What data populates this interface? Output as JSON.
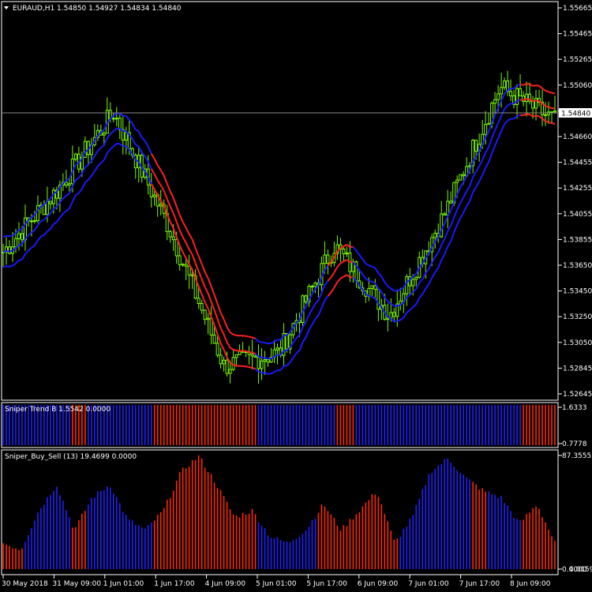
{
  "main_pane": {
    "title": "EURAUD,H1 1.54850 1.54927 1.54834 1.54840",
    "current_price_label": "1.54840",
    "price_ticks": [
      "1.55665",
      "1.55465",
      "1.55265",
      "1.55060",
      "1.54860",
      "1.54660",
      "1.54455",
      "1.54255",
      "1.54055",
      "1.53855",
      "1.53650",
      "1.53450",
      "1.53250",
      "1.53050",
      "1.52845",
      "1.52645"
    ]
  },
  "indicator1": {
    "title": "Sniper Trend B 1.5542 0.0000",
    "ticks": [
      "1.6333",
      "0.7778"
    ]
  },
  "indicator2": {
    "title": "Sniper_Buy_Sell (13) 19.4699 0.0000",
    "ticks": [
      "87.3555",
      "0.0000",
      "4.01598"
    ]
  },
  "time_axis": {
    "labels": [
      "30 May 2018",
      "31 May 09:00",
      "1 Jun 01:00",
      "1 Jun 17:00",
      "4 Jun 09:00",
      "5 Jun 01:00",
      "5 Jun 17:00",
      "6 Jun 09:00",
      "7 Jun 01:00",
      "7 Jun 17:00",
      "8 Jun 09:00"
    ]
  },
  "colors": {
    "background": "#000000",
    "frame": "#ffffff",
    "candles": "#7cfc00",
    "band_up": "#1a1aff",
    "band_down": "#ff2020",
    "hist_red": "#ff2a00",
    "hist_blue": "#2020ff",
    "price_line": "#8c8c8c"
  },
  "chart_data": {
    "type": "candlestick",
    "symbol": "EURAUD",
    "timeframe": "H1",
    "ylim": [
      1.5264,
      1.5576
    ],
    "last_close": 1.5484,
    "price_keypoints": [
      {
        "x": "30 May 2018",
        "price": 1.538
      },
      {
        "x": "31 May 09:00",
        "price": 1.543
      },
      {
        "x": "1 Jun 01:00",
        "price": 1.549
      },
      {
        "x": "1 Jun 17:00",
        "price": 1.54
      },
      {
        "x": "4 Jun 09:00",
        "price": 1.529
      },
      {
        "x": "5 Jun 01:00",
        "price": 1.53
      },
      {
        "x": "5 Jun 17:00",
        "price": 1.5385
      },
      {
        "x": "6 Jun 09:00",
        "price": 1.533
      },
      {
        "x": "7 Jun 01:00",
        "price": 1.541
      },
      {
        "x": "7 Jun 17:00",
        "price": 1.551
      },
      {
        "x": "8 Jun 09:00",
        "price": 1.5484
      }
    ],
    "sniper_trend_regimes": [
      {
        "from": "30 May 2018",
        "color": "blue"
      },
      {
        "from": "31 May 09:00",
        "color": "red",
        "note": "short"
      },
      {
        "from": "31 May 09:00",
        "color": "blue"
      },
      {
        "from": "1 Jun 17:00",
        "color": "red"
      },
      {
        "from": "5 Jun 01:00",
        "color": "blue"
      },
      {
        "from": "6 Jun 09:00",
        "color": "red",
        "note": "short"
      },
      {
        "from": "6 Jun 09:00",
        "color": "blue"
      },
      {
        "from": "8 Jun 09:00",
        "color": "red"
      }
    ],
    "sniper_buy_sell_ylim": [
      0,
      87.3555
    ],
    "sniper_buy_sell_last": 19.4699
  }
}
